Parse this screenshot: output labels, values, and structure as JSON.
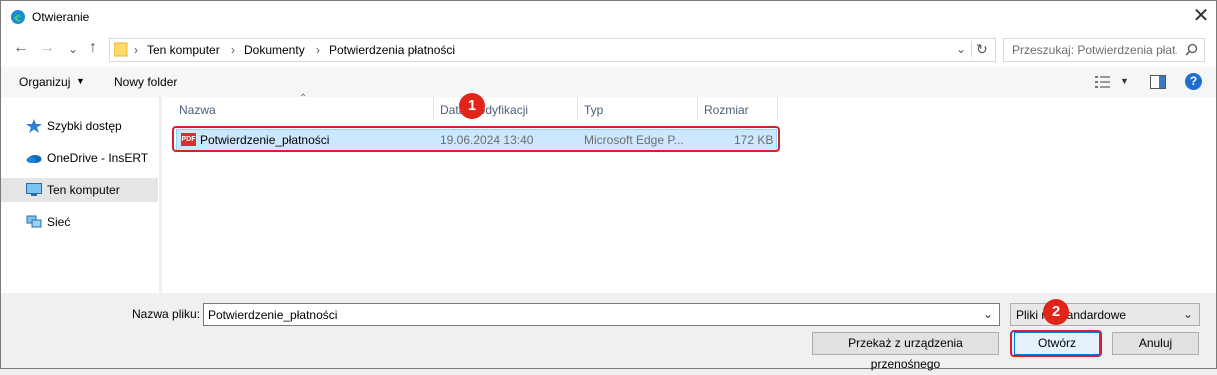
{
  "window": {
    "title": "Otwieranie"
  },
  "nav": {
    "back_icon": "←",
    "forward_icon": "→",
    "recent_icon": "⌄",
    "up_icon": "↑",
    "breadcrumb": [
      "Ten komputer",
      "Dokumenty",
      "Potwierdzenia płatności"
    ],
    "search_placeholder": "Przeszukaj: Potwierdzenia płat..."
  },
  "toolbar": {
    "organize": "Organizuj",
    "new_folder": "Nowy folder",
    "help": "?"
  },
  "sidebar": {
    "items": [
      {
        "label": "Szybki dostęp",
        "icon": "star-icon"
      },
      {
        "label": "OneDrive - InsERT",
        "icon": "cloud-icon"
      },
      {
        "label": "Ten komputer",
        "icon": "computer-icon",
        "selected": true
      },
      {
        "label": "Sieć",
        "icon": "network-icon"
      }
    ]
  },
  "columns": [
    "Nazwa",
    "Data modyfikacji",
    "Typ",
    "Rozmiar"
  ],
  "files": [
    {
      "name": "Potwierdzenie_płatności",
      "modified": "19.06.2024 13:40",
      "type": "Microsoft Edge P...",
      "size": "172 KB",
      "icon": "pdf-icon",
      "icon_text": "PDF"
    }
  ],
  "badges": [
    "1",
    "2"
  ],
  "footer": {
    "filename_label": "Nazwa pliku:",
    "filename_value": "Potwierdzenie_płatności",
    "filetype_value": "Pliki niestandardowe",
    "transfer_button": "Przekaż z urządzenia przenośnego",
    "open_button": "Otwórz",
    "cancel_button": "Anuluj"
  },
  "colors": {
    "selection": "#cce8ff",
    "highlight": "#d6202c",
    "badge": "#e1251b"
  }
}
